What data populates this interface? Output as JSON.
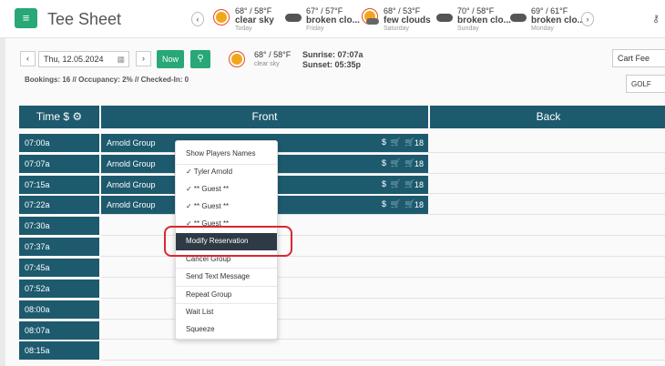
{
  "header": {
    "title": "Tee Sheet",
    "forecast": [
      {
        "temp": "68° / 58°F",
        "condition": "clear sky",
        "day": "Today",
        "icon": "sun-icon"
      },
      {
        "temp": "67° / 57°F",
        "condition": "broken clo...",
        "day": "Friday",
        "icon": "cloud-icon"
      },
      {
        "temp": "68° / 53°F",
        "condition": "few clouds",
        "day": "Saturday",
        "icon": "sun-cloud-icon"
      },
      {
        "temp": "70° / 58°F",
        "condition": "broken clo...",
        "day": "Sunday",
        "icon": "cloud-icon"
      },
      {
        "temp": "69° / 61°F",
        "condition": "broken clo...",
        "day": "Monday",
        "icon": "cloud-icon"
      }
    ]
  },
  "toolbar": {
    "date": "Thu, 12.05.2024",
    "now_label": "Now",
    "current_weather": {
      "temp": "68° / 58°F",
      "condition": "clear sky"
    },
    "sunrise": "Sunrise: 07:07a",
    "sunset": "Sunset: 05:35p",
    "stats": "Bookings: 16 // Occupancy: 2% // Checked-In: 0",
    "cart_fee": "Cart Fee",
    "course": "GOLF"
  },
  "grid": {
    "time_header": "Time $",
    "columns": [
      "Front",
      "Back"
    ],
    "times": [
      "07:00a",
      "07:07a",
      "07:15a",
      "07:22a",
      "07:30a",
      "07:37a",
      "07:45a",
      "07:52a",
      "08:00a",
      "08:07a",
      "08:15a"
    ],
    "bookings": [
      {
        "group": "Arnold Group",
        "holes": "18"
      },
      {
        "group": "Arnold Group",
        "holes": "18"
      },
      {
        "group": "Arnold Group",
        "holes": "18"
      },
      {
        "group": "Arnold Group",
        "holes": "18"
      }
    ],
    "booking_icons": "$ 🛒 🛒"
  },
  "context_menu": {
    "items": [
      "Show Players Names",
      "✓ Tyler Arnold",
      "✓ ** Guest **",
      "✓ ** Guest **",
      "✓ ** Guest **",
      "Modify Reservation",
      "Cancel Group",
      "Send Text Message",
      "Repeat Group",
      "Wait List",
      "Squeeze"
    ]
  },
  "colors": {
    "accent": "#27a876",
    "grid_header": "#1d5a6e",
    "menu_active": "#2e3a45",
    "highlight": "#d9282f"
  }
}
